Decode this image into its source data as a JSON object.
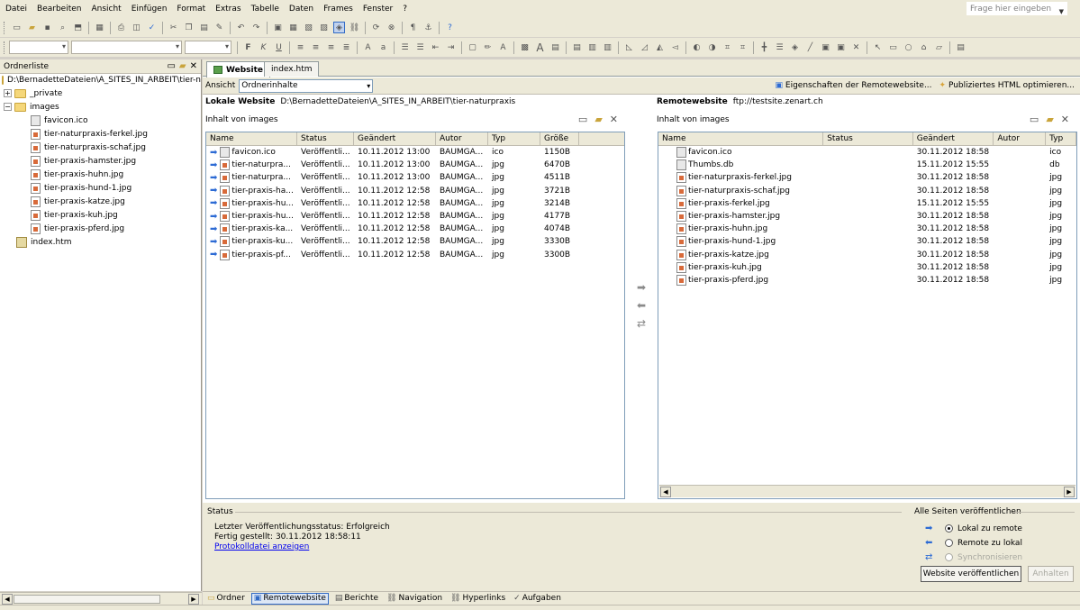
{
  "menu": [
    "Datei",
    "Bearbeiten",
    "Ansicht",
    "Einfügen",
    "Format",
    "Extras",
    "Tabelle",
    "Daten",
    "Frames",
    "Fenster",
    "?"
  ],
  "help_placeholder": "Frage hier eingeben",
  "folder_list": {
    "title": "Ordnerliste",
    "root_path": "D:\\BernadetteDateien\\A_SITES_IN_ARBEIT\\tier-na",
    "items": [
      {
        "label": "_private",
        "type": "folder",
        "level": 0,
        "expander": "+"
      },
      {
        "label": "images",
        "type": "folder",
        "level": 0,
        "expander": "−"
      },
      {
        "label": "favicon.ico",
        "type": "ico",
        "level": 1
      },
      {
        "label": "tier-naturpraxis-ferkel.jpg",
        "type": "jpg",
        "level": 1
      },
      {
        "label": "tier-naturpraxis-schaf.jpg",
        "type": "jpg",
        "level": 1
      },
      {
        "label": "tier-praxis-hamster.jpg",
        "type": "jpg",
        "level": 1
      },
      {
        "label": "tier-praxis-huhn.jpg",
        "type": "jpg",
        "level": 1
      },
      {
        "label": "tier-praxis-hund-1.jpg",
        "type": "jpg",
        "level": 1
      },
      {
        "label": "tier-praxis-katze.jpg",
        "type": "jpg",
        "level": 1
      },
      {
        "label": "tier-praxis-kuh.jpg",
        "type": "jpg",
        "level": 1
      },
      {
        "label": "tier-praxis-pferd.jpg",
        "type": "jpg",
        "level": 1
      },
      {
        "label": "index.htm",
        "type": "htm",
        "level": -1
      }
    ]
  },
  "tabs": [
    "Website",
    "index.htm"
  ],
  "view": {
    "label": "Ansicht",
    "value": "Ordnerinhalte"
  },
  "links": {
    "remote_props": "Eigenschaften der Remotewebsite...",
    "optimize": "Publiziertes HTML optimieren..."
  },
  "local": {
    "title": "Lokale Website",
    "path": "D:\\BernadetteDateien\\A_SITES_IN_ARBEIT\\tier-naturpraxis",
    "content_label": "Inhalt von images",
    "columns": [
      "Name",
      "Status",
      "Geändert",
      "Autor",
      "Typ",
      "Größe"
    ],
    "rows": [
      [
        "favicon.ico",
        "Veröffentli...",
        "10.11.2012 13:00",
        "BAUMGA...",
        "ico",
        "1150B"
      ],
      [
        "tier-naturpra...",
        "Veröffentli...",
        "10.11.2012 13:00",
        "BAUMGA...",
        "jpg",
        "6470B"
      ],
      [
        "tier-naturpra...",
        "Veröffentli...",
        "10.11.2012 13:00",
        "BAUMGA...",
        "jpg",
        "4511B"
      ],
      [
        "tier-praxis-ha...",
        "Veröffentli...",
        "10.11.2012 12:58",
        "BAUMGA...",
        "jpg",
        "3721B"
      ],
      [
        "tier-praxis-hu...",
        "Veröffentli...",
        "10.11.2012 12:58",
        "BAUMGA...",
        "jpg",
        "3214B"
      ],
      [
        "tier-praxis-hu...",
        "Veröffentli...",
        "10.11.2012 12:58",
        "BAUMGA...",
        "jpg",
        "4177B"
      ],
      [
        "tier-praxis-ka...",
        "Veröffentli...",
        "10.11.2012 12:58",
        "BAUMGA...",
        "jpg",
        "4074B"
      ],
      [
        "tier-praxis-ku...",
        "Veröffentli...",
        "10.11.2012 12:58",
        "BAUMGA...",
        "jpg",
        "3330B"
      ],
      [
        "tier-praxis-pf...",
        "Veröffentli...",
        "10.11.2012 12:58",
        "BAUMGA...",
        "jpg",
        "3300B"
      ]
    ]
  },
  "remote": {
    "title": "Remotewebsite",
    "path": "ftp://testsite.zenart.ch",
    "content_label": "Inhalt von images",
    "columns": [
      "Name",
      "Status",
      "Geändert",
      "Autor",
      "Typ"
    ],
    "rows": [
      [
        "favicon.ico",
        "",
        "30.11.2012 18:58",
        "",
        "ico"
      ],
      [
        "Thumbs.db",
        "",
        "15.11.2012 15:55",
        "",
        "db"
      ],
      [
        "tier-naturpraxis-ferkel.jpg",
        "",
        "30.11.2012 18:58",
        "",
        "jpg"
      ],
      [
        "tier-naturpraxis-schaf.jpg",
        "",
        "30.11.2012 18:58",
        "",
        "jpg"
      ],
      [
        "tier-praxis-ferkel.jpg",
        "",
        "15.11.2012 15:55",
        "",
        "jpg"
      ],
      [
        "tier-praxis-hamster.jpg",
        "",
        "30.11.2012 18:58",
        "",
        "jpg"
      ],
      [
        "tier-praxis-huhn.jpg",
        "",
        "30.11.2012 18:58",
        "",
        "jpg"
      ],
      [
        "tier-praxis-hund-1.jpg",
        "",
        "30.11.2012 18:58",
        "",
        "jpg"
      ],
      [
        "tier-praxis-katze.jpg",
        "",
        "30.11.2012 18:58",
        "",
        "jpg"
      ],
      [
        "tier-praxis-kuh.jpg",
        "",
        "30.11.2012 18:58",
        "",
        "jpg"
      ],
      [
        "tier-praxis-pferd.jpg",
        "",
        "30.11.2012 18:58",
        "",
        "jpg"
      ]
    ]
  },
  "status": {
    "heading": "Status",
    "last_status": "Letzter Veröffentlichungsstatus: Erfolgreich",
    "finished": "Fertig gestellt: 30.11.2012 18:58:11",
    "log_link": "Protokolldatei anzeigen"
  },
  "publish": {
    "heading": "Alle Seiten veröffentlichen",
    "options": [
      "Lokal zu remote",
      "Remote zu lokal",
      "Synchronisieren"
    ],
    "selected": 0,
    "publish_button": "Website veröffentlichen",
    "stop_button": "Anhalten"
  },
  "views": [
    "Ordner",
    "Remotewebsite",
    "Berichte",
    "Navigation",
    "Hyperlinks",
    "Aufgaben"
  ],
  "active_view": 1,
  "colors": {
    "accent": "#316ac5",
    "arrow": "#2d6bd4",
    "toolbar_bg": "#ece9d8"
  }
}
